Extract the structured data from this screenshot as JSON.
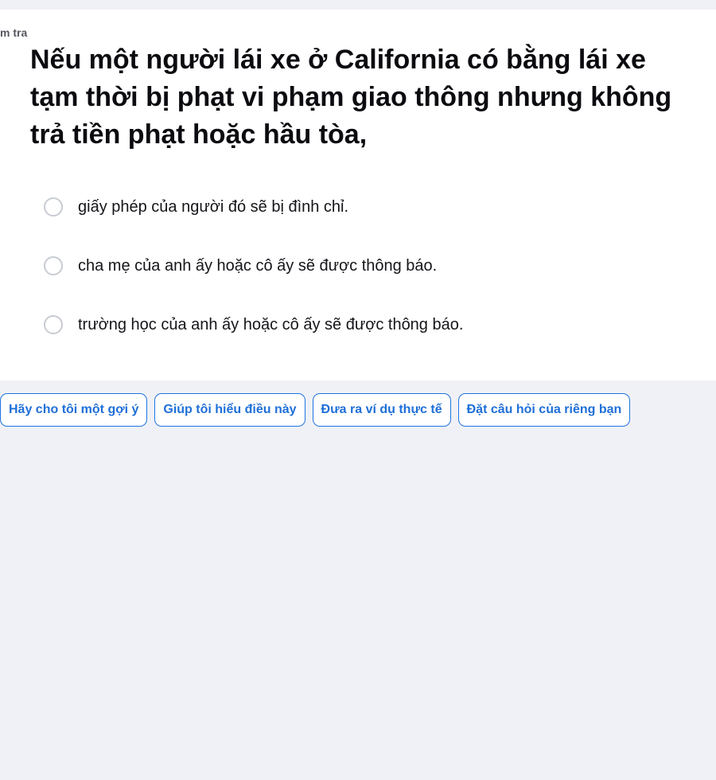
{
  "card": {
    "label": "m tra",
    "question": "Nếu một người lái xe ở California có bằng lái xe tạm thời bị phạt vi phạm giao thông nhưng không trả tiền phạt hoặc hầu tòa,"
  },
  "options": [
    {
      "label": "giấy phép của người đó sẽ bị đình chỉ.",
      "selected": false
    },
    {
      "label": "cha mẹ của anh ấy hoặc cô ấy sẽ được thông báo.",
      "selected": false
    },
    {
      "label": "trường học của anh ấy hoặc cô ấy sẽ được thông báo.",
      "selected": false
    }
  ],
  "actions": [
    {
      "label": "Hãy cho tôi một gợi ý"
    },
    {
      "label": "Giúp tôi hiểu điều này"
    },
    {
      "label": "Đưa ra ví dụ thực tế"
    },
    {
      "label": "Đặt câu hỏi của riêng bạn"
    }
  ],
  "colors": {
    "background": "#f0f1f6",
    "card": "#ffffff",
    "accent": "#1f74e0",
    "radio_border": "#c8cbd2"
  }
}
